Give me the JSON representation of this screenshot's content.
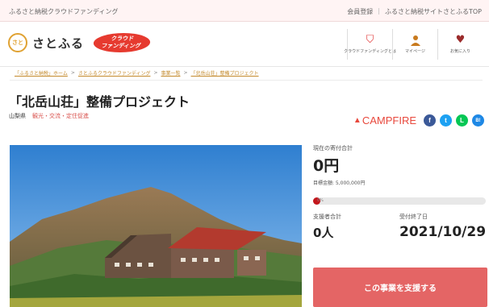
{
  "topbar": {
    "tagline": "ふるさと納税クラウドファンディング",
    "links": [
      "会員登録",
      "ふるさと納税サイトさとふるTOP"
    ]
  },
  "header": {
    "logo_text": "さとふる",
    "logo_mark_text": "さと",
    "badge_line1": "クラウド",
    "badge_line2": "ファンディング",
    "nav": [
      {
        "label": "クラウドファンディングとは",
        "icon": "shield-icon"
      },
      {
        "label": "マイページ",
        "icon": "user-icon"
      },
      {
        "label": "お気に入り",
        "icon": "heart-icon"
      }
    ]
  },
  "breadcrumb": [
    "「ふるさと納税」ホーム",
    "さとふるクラウドファンディング",
    "事業一覧",
    "「北岳山荘」整備プロジェクト"
  ],
  "project": {
    "title": "「北岳山荘」整備プロジェクト",
    "prefecture": "山梨県",
    "category": "観光・交流・定住促進"
  },
  "share": {
    "campfire_label": "CAMPFIRE",
    "facebook": "f",
    "twitter": "t",
    "line": "L",
    "hatena": "B!"
  },
  "stats": {
    "current_label": "現在の寄付合計",
    "current_amount": "0円",
    "goal_text": "目標金額: 5,000,000円",
    "progress_text": "0%",
    "progress": 0,
    "supporters_label": "支援者合計",
    "supporters_value": "0人",
    "deadline_label": "受付終了日",
    "deadline_value": "2021/10/29"
  },
  "cta": {
    "label": "この事業を支援する"
  },
  "colors": {
    "accent": "#e46565",
    "brand_red": "#e63a2f",
    "breadcrumb": "#c48a2c"
  }
}
